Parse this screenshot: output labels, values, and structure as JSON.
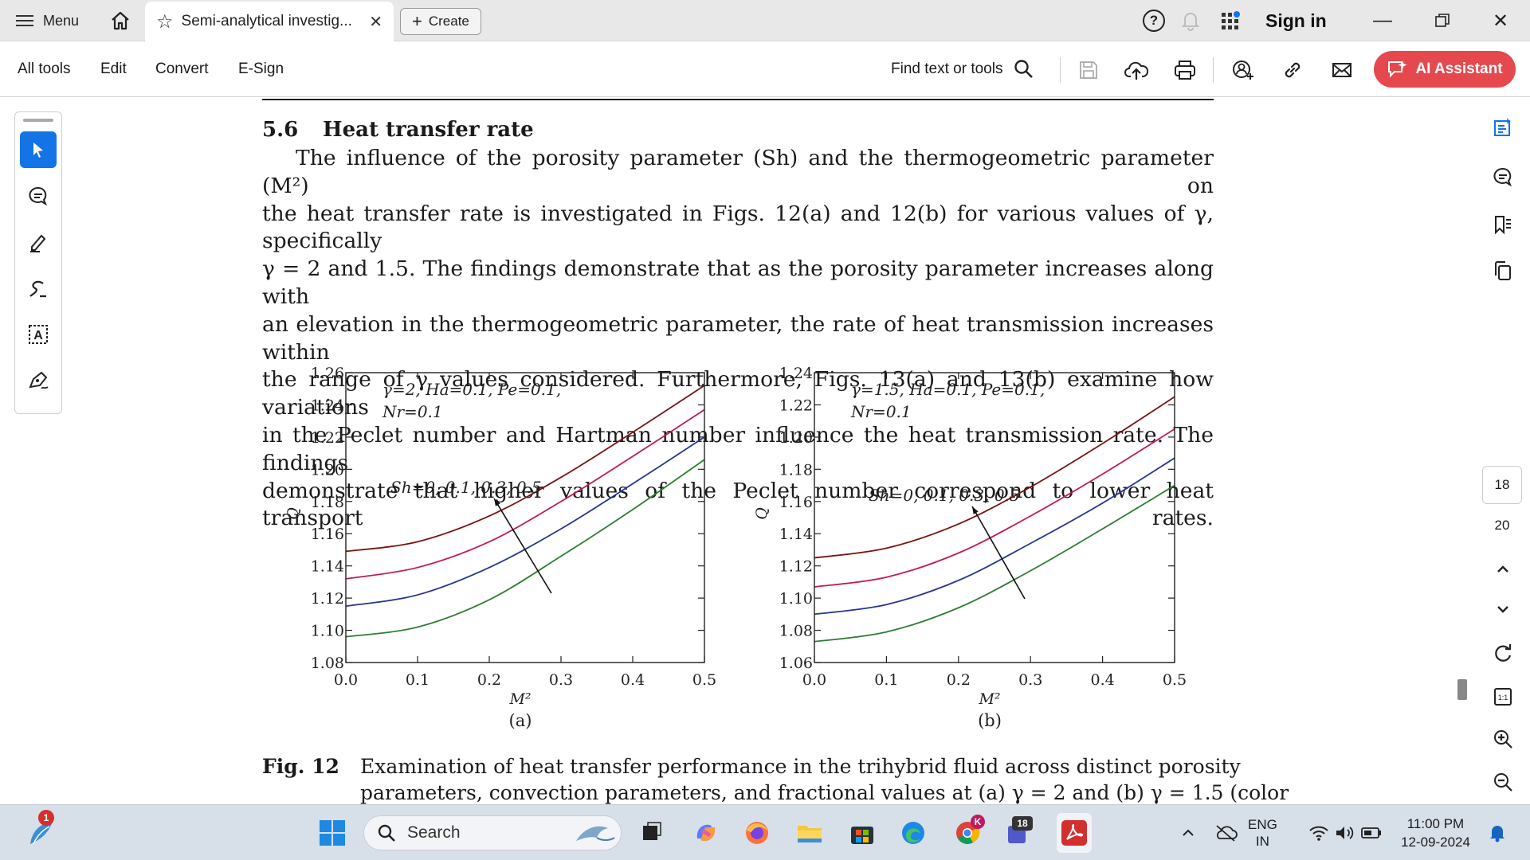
{
  "window": {
    "menu_label": "Menu",
    "tab_title": "Semi-analytical investig...",
    "create_label": "Create",
    "help_symbol": "?",
    "sign_in_label": "Sign in"
  },
  "toolbar": {
    "items": [
      "All tools",
      "Edit",
      "Convert",
      "E-Sign"
    ],
    "find_label": "Find text or tools",
    "ai_label": "AI Assistant"
  },
  "right_rail": {
    "page_current": "18",
    "page_total": "20"
  },
  "document": {
    "section_number": "5.6",
    "section_title": "Heat transfer rate",
    "paragraph_lines": [
      "The influence of the porosity parameter (Sh) and the thermogeometric parameter (M²) on",
      "the heat transfer rate is investigated in Figs. 12(a) and 12(b) for various values of γ, specifically",
      "γ = 2 and 1.5.  The findings demonstrate that as the porosity parameter increases along with",
      "an elevation in the thermogeometric parameter, the rate of heat transmission increases within",
      "the range of γ values considered.  Furthermore, Figs. 13(a) and 13(b) examine how variations",
      "in the Peclet number and Hartman number influence the heat transmission rate.  The findings",
      "demonstrate that higher values of the Peclet number correspond to lower heat transport rates."
    ],
    "caption_label": "Fig. 12",
    "caption_lines": [
      "Examination of heat transfer performance in the trihybrid fluid across distinct porosity",
      "parameters, convection parameters, and fractional values at (a) γ = 2 and (b) γ = 1.5 (color"
    ]
  },
  "chart_data": [
    {
      "type": "line",
      "panel_label": "(a)",
      "xlabel": "M²",
      "ylabel": "Q",
      "xlim": [
        0.0,
        0.5
      ],
      "ylim": [
        1.08,
        1.26
      ],
      "xticks": [
        "0.0",
        "0.1",
        "0.2",
        "0.3",
        "0.4",
        "0.5"
      ],
      "yticks": [
        "1.08",
        "1.10",
        "1.12",
        "1.14",
        "1.16",
        "1.18",
        "1.20",
        "1.22",
        "1.24",
        "1.26"
      ],
      "annotation_lines": [
        "γ=2, Ha=0.1, Pe=0.1,",
        "Nr=0.1"
      ],
      "arrow_label": "Sh=0, 0.1, 0.3, 0.5",
      "x": [
        0.0,
        0.1,
        0.2,
        0.3,
        0.4,
        0.5
      ],
      "series": [
        {
          "color": "#2e7d32",
          "values": [
            1.096,
            1.102,
            1.119,
            1.146,
            1.175,
            1.206
          ]
        },
        {
          "color": "#283593",
          "values": [
            1.115,
            1.122,
            1.139,
            1.163,
            1.191,
            1.22
          ]
        },
        {
          "color": "#c2185b",
          "values": [
            1.132,
            1.139,
            1.155,
            1.18,
            1.208,
            1.237
          ]
        },
        {
          "color": "#7b1212",
          "values": [
            1.149,
            1.155,
            1.171,
            1.195,
            1.223,
            1.252
          ]
        }
      ]
    },
    {
      "type": "line",
      "panel_label": "(b)",
      "xlabel": "M²",
      "ylabel": "Q",
      "xlim": [
        0.0,
        0.5
      ],
      "ylim": [
        1.06,
        1.24
      ],
      "xticks": [
        "0.0",
        "0.1",
        "0.2",
        "0.3",
        "0.4",
        "0.5"
      ],
      "yticks": [
        "1.06",
        "1.08",
        "1.10",
        "1.12",
        "1.14",
        "1.16",
        "1.18",
        "1.20",
        "1.22",
        "1.24"
      ],
      "annotation_lines": [
        "γ=1.5, Ha=0.1, Pe=0.1,",
        "Nr=0.1"
      ],
      "arrow_label": "Sh=0, 0.1, 0.3, 0.5",
      "x": [
        0.0,
        0.1,
        0.2,
        0.3,
        0.4,
        0.5
      ],
      "series": [
        {
          "color": "#2e7d32",
          "values": [
            1.073,
            1.079,
            1.094,
            1.117,
            1.143,
            1.17
          ]
        },
        {
          "color": "#283593",
          "values": [
            1.09,
            1.096,
            1.111,
            1.134,
            1.159,
            1.187
          ]
        },
        {
          "color": "#c2185b",
          "values": [
            1.107,
            1.113,
            1.128,
            1.151,
            1.177,
            1.205
          ]
        },
        {
          "color": "#7b1212",
          "values": [
            1.125,
            1.131,
            1.146,
            1.169,
            1.196,
            1.225
          ]
        }
      ]
    }
  ],
  "taskbar": {
    "search_label": "Search",
    "lang_line1": "ENG",
    "lang_line2": "IN",
    "time": "11:00 PM",
    "date": "12-09-2024",
    "notification_count": "1",
    "teams_badge": "18"
  },
  "colors": {
    "accent": "#e5484d",
    "tool_active": "#1473e6",
    "tabbar": "#e8e8e8",
    "taskbar": "#d7dfe9"
  }
}
